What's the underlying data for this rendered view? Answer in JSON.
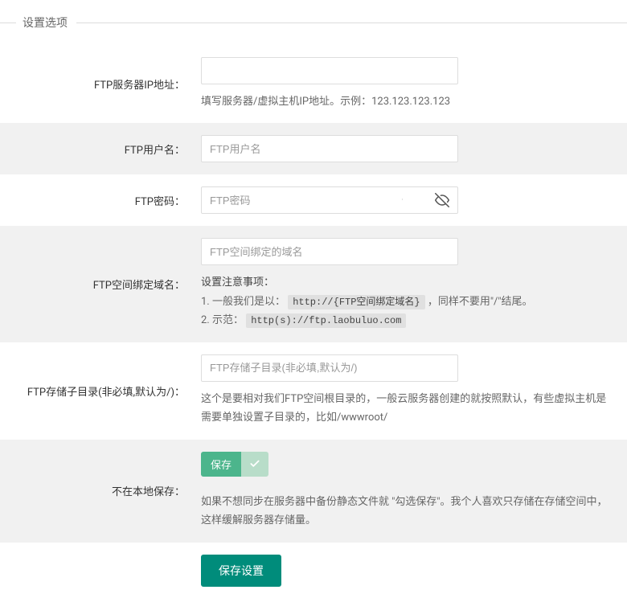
{
  "fieldset_title": "设置选项",
  "rows": {
    "ftp_ip": {
      "label": "FTP服务器IP地址：",
      "help": "填写服务器/虚拟主机IP地址。示例：123.123.123.123"
    },
    "ftp_user": {
      "label": "FTP用户名：",
      "placeholder": "FTP用户名"
    },
    "ftp_password": {
      "label": "FTP密码：",
      "placeholder": "FTP密码"
    },
    "ftp_domain": {
      "label": "FTP空间绑定域名：",
      "placeholder": "FTP空间绑定的域名",
      "notes_title": "设置注意事项：",
      "note1_prefix": "1. 一般我们是以：",
      "note1_code": "http://{FTP空间绑定域名}",
      "note1_suffix": " ，同样不要用\"/\"结尾。",
      "note2_prefix": "2. 示范：",
      "note2_code": "http(s)://ftp.laobuluo.com"
    },
    "ftp_subdir": {
      "label": "FTP存储子目录(非必填,默认为/)：",
      "placeholder": "FTP存储子目录(非必填,默认为/)",
      "help": "这个是要相对我们FTP空间根目录的，一般云服务器创建的就按照默认，有些虚拟主机是需要单独设置子目录的，比如/wwwroot/"
    },
    "local_save": {
      "label": "不在本地保存：",
      "toggle_label": "保存",
      "help": "如果不想同步在服务器中备份静态文件就 \"勾选保存\"。我个人喜欢只存储在存储空间中，这样缓解服务器存储量。"
    }
  },
  "submit_label": "保存设置"
}
